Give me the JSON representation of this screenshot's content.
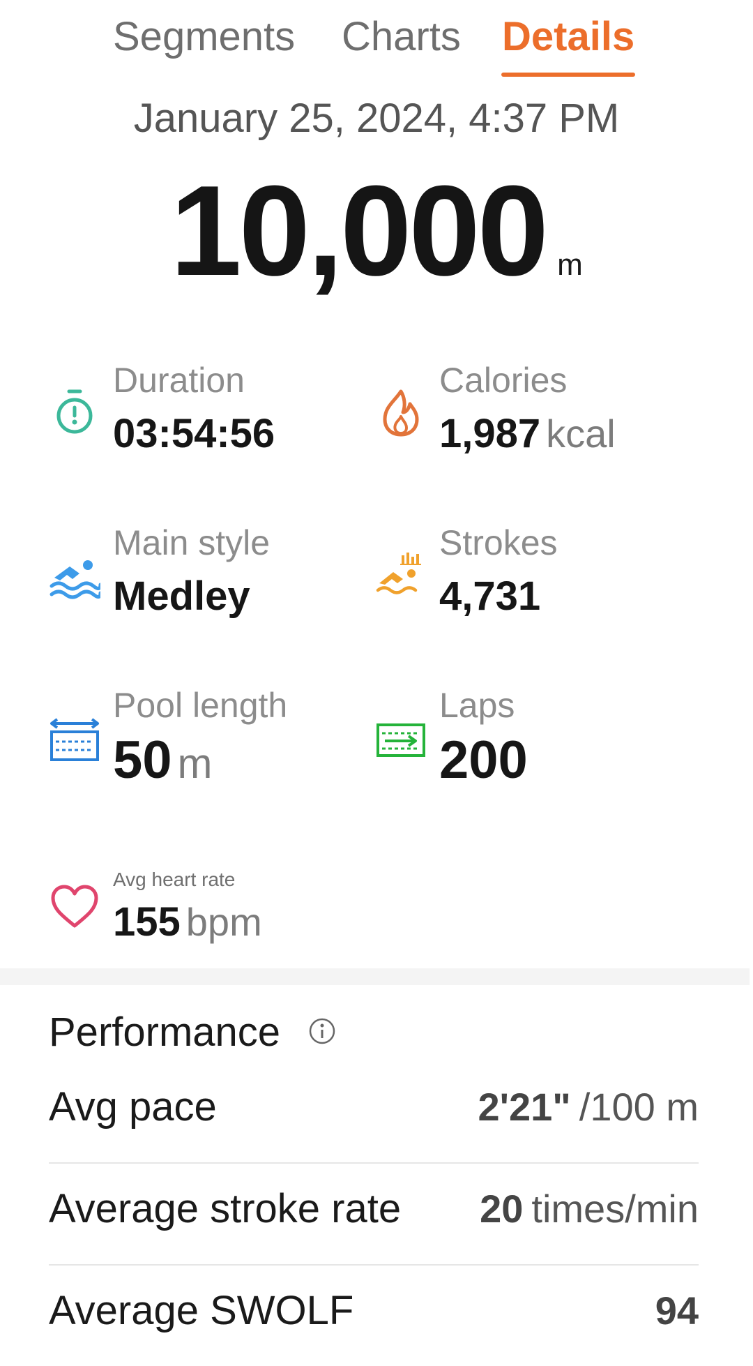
{
  "tabs": {
    "segments": "Segments",
    "charts": "Charts",
    "details": "Details",
    "active_color": "#ec6e2b"
  },
  "header": {
    "date": "January 25, 2024, 4:37 PM",
    "distance_value": "10,000",
    "distance_unit": "m"
  },
  "stats": {
    "duration": {
      "label": "Duration",
      "value": "03:54:56",
      "icon": "stopwatch-icon",
      "color": "#3cb89a"
    },
    "calories": {
      "label": "Calories",
      "value": "1,987",
      "unit": "kcal",
      "icon": "flame-icon",
      "color": "#e2743a"
    },
    "main_style": {
      "label": "Main style",
      "value": "Medley",
      "icon": "swimmer-icon",
      "color": "#3d9be9"
    },
    "strokes": {
      "label": "Strokes",
      "value": "4,731",
      "icon": "swimmer-strokes-icon",
      "color": "#f0a12c"
    },
    "pool_length": {
      "label": "Pool length",
      "value": "50",
      "unit": "m",
      "icon": "pool-length-icon",
      "color": "#2a80d8"
    },
    "laps": {
      "label": "Laps",
      "value": "200",
      "icon": "laps-icon",
      "color": "#25b33a"
    },
    "heart_rate": {
      "label": "Avg heart rate",
      "value": "155",
      "unit": "bpm",
      "icon": "heart-icon",
      "color": "#e0456d"
    }
  },
  "performance": {
    "title": "Performance",
    "rows": [
      {
        "label": "Avg pace",
        "value": "2'21\"",
        "unit": "/100 m"
      },
      {
        "label": "Average stroke rate",
        "value": "20",
        "unit": "times/min"
      },
      {
        "label": "Average SWOLF",
        "value": "94",
        "unit": ""
      }
    ]
  }
}
